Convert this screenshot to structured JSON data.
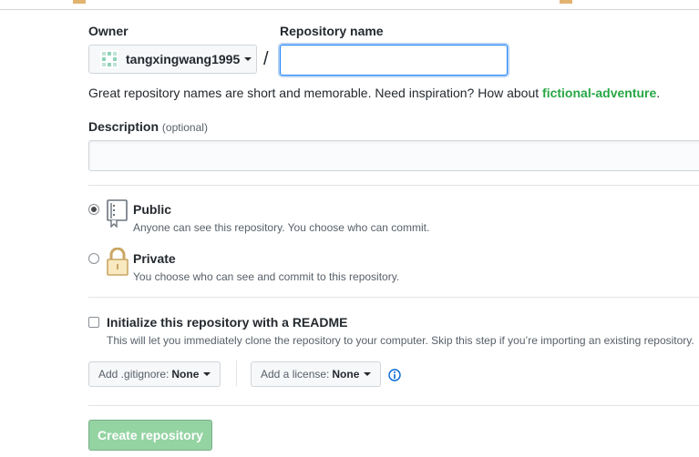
{
  "owner": {
    "label": "Owner",
    "username": "tangxingwang1995"
  },
  "repo_name": {
    "label": "Repository name",
    "value": "",
    "separator": "/"
  },
  "hint": {
    "text": "Great repository names are short and memorable. Need inspiration? How about ",
    "suggestion": "fictional-adventure",
    "end": "."
  },
  "description": {
    "label": "Description",
    "optional": "(optional)",
    "value": ""
  },
  "visibility": {
    "public": {
      "title": "Public",
      "note": "Anyone can see this repository. You choose who can commit.",
      "selected": true
    },
    "private": {
      "title": "Private",
      "note": "You choose who can see and commit to this repository.",
      "selected": false
    }
  },
  "readme": {
    "title": "Initialize this repository with a README",
    "note": "This will let you immediately clone the repository to your computer. Skip this step if you’re importing an existing repository.",
    "checked": false
  },
  "gitignore": {
    "label": "Add .gitignore:",
    "value": "None"
  },
  "license": {
    "label": "Add a license:",
    "value": "None"
  },
  "icons": {
    "info": "info-icon",
    "public": "repo-book-icon",
    "private": "lock-icon"
  },
  "submit": {
    "label": "Create repository"
  },
  "colors": {
    "suggestion": "#28a745",
    "submit_bg": "#94d3a2",
    "focus": "#2188ff"
  }
}
